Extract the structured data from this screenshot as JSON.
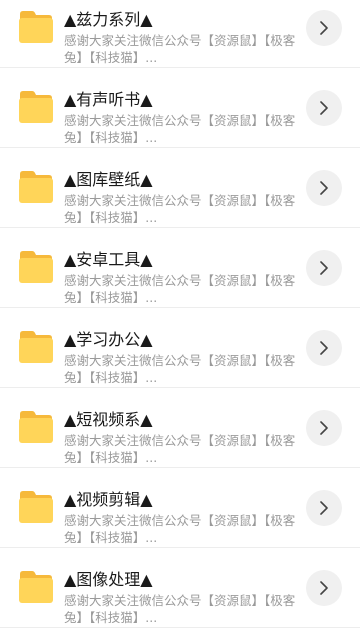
{
  "folders": [
    {
      "title": "▲兹力系列▲",
      "description": "感谢大家关注微信公众号【资源鼠】【极客兔】【科技猫】..."
    },
    {
      "title": "▲有声听书▲",
      "description": "感谢大家关注微信公众号【资源鼠】【极客兔】【科技猫】..."
    },
    {
      "title": "▲图库壁纸▲",
      "description": "感谢大家关注微信公众号【资源鼠】【极客兔】【科技猫】..."
    },
    {
      "title": "▲安卓工具▲",
      "description": "感谢大家关注微信公众号【资源鼠】【极客兔】【科技猫】..."
    },
    {
      "title": "▲学习办公▲",
      "description": "感谢大家关注微信公众号【资源鼠】【极客兔】【科技猫】..."
    },
    {
      "title": "▲短视频系▲",
      "description": "感谢大家关注微信公众号【资源鼠】【极客兔】【科技猫】..."
    },
    {
      "title": "▲视频剪辑▲",
      "description": "感谢大家关注微信公众号【资源鼠】【极客兔】【科技猫】..."
    },
    {
      "title": "▲图像处理▲",
      "description": "感谢大家关注微信公众号【资源鼠】【极客兔】【科技猫】..."
    }
  ],
  "icons": {
    "folder": "folder-icon",
    "more": "chevron-right-icon"
  },
  "colors": {
    "folder_body": "#FFD559",
    "folder_tab": "#F6B93B",
    "title_text": "#1a1a1a",
    "description_text": "#9a9a9a",
    "more_button_bg": "#f0f0f0"
  }
}
